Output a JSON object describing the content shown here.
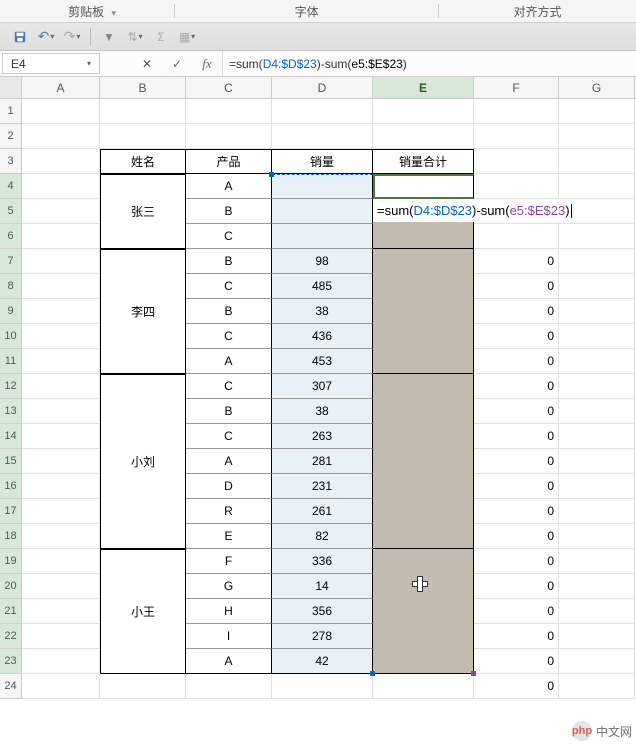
{
  "ribbon": {
    "clipboard": "剪贴板",
    "font": "字体",
    "alignment": "对齐方式"
  },
  "namebox": "E4",
  "formula": {
    "prefix": "=sum(",
    "ref1": "D4:$D$23",
    "mid": ")-sum(",
    "ref2": "e5:$E$23",
    "suffix": ")"
  },
  "columns": [
    "A",
    "B",
    "C",
    "D",
    "E",
    "F",
    "G"
  ],
  "headers": {
    "name": "姓名",
    "product": "产品",
    "sales": "销量",
    "total": "销量合计"
  },
  "rows": [
    {
      "r": 4,
      "name": "张三",
      "nameSpan": 3,
      "prod": "A",
      "sales": "",
      "f": ""
    },
    {
      "r": 5,
      "prod": "B",
      "sales": "",
      "f": ""
    },
    {
      "r": 6,
      "prod": "C",
      "sales": "",
      "f": ""
    },
    {
      "r": 7,
      "name": "李四",
      "nameSpan": 5,
      "prod": "B",
      "sales": "98",
      "f": "0"
    },
    {
      "r": 8,
      "prod": "C",
      "sales": "485",
      "f": "0"
    },
    {
      "r": 9,
      "prod": "B",
      "sales": "38",
      "f": "0"
    },
    {
      "r": 10,
      "prod": "C",
      "sales": "436",
      "f": "0"
    },
    {
      "r": 11,
      "prod": "A",
      "sales": "453",
      "f": "0"
    },
    {
      "r": 12,
      "name": "小刘",
      "nameSpan": 7,
      "prod": "C",
      "sales": "307",
      "f": "0"
    },
    {
      "r": 13,
      "prod": "B",
      "sales": "38",
      "f": "0"
    },
    {
      "r": 14,
      "prod": "C",
      "sales": "263",
      "f": "0"
    },
    {
      "r": 15,
      "prod": "A",
      "sales": "281",
      "f": "0"
    },
    {
      "r": 16,
      "prod": "D",
      "sales": "231",
      "f": "0"
    },
    {
      "r": 17,
      "prod": "R",
      "sales": "261",
      "f": "0"
    },
    {
      "r": 18,
      "prod": "E",
      "sales": "82",
      "f": "0"
    },
    {
      "r": 19,
      "name": "小王",
      "nameSpan": 5,
      "prod": "F",
      "sales": "336",
      "f": "0"
    },
    {
      "r": 20,
      "prod": "G",
      "sales": "14",
      "f": "0"
    },
    {
      "r": 21,
      "prod": "H",
      "sales": "356",
      "f": "0"
    },
    {
      "r": 22,
      "prod": "I",
      "sales": "278",
      "f": "0"
    },
    {
      "r": 23,
      "prod": "A",
      "sales": "42",
      "f": "0"
    }
  ],
  "row24_f": "0",
  "watermark": {
    "logo": "php",
    "text": "中文网"
  },
  "chart_data": null
}
